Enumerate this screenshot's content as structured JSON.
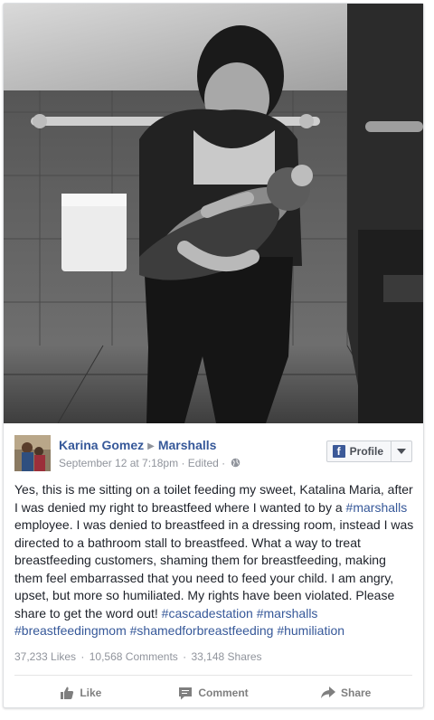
{
  "post": {
    "author": "Karina Gomez",
    "target": "Marshalls",
    "timestamp": "September 12 at 7:18pm",
    "edited": "Edited",
    "body_segments": [
      {
        "text": "Yes, this is me sitting on a toilet feeding my sweet, Katalina Maria, after I was denied my right to breastfeed where I wanted to by a ",
        "tag": false
      },
      {
        "text": "#marshalls",
        "tag": true
      },
      {
        "text": " employee. I was denied to breastfeed in a dressing room, instead I was directed to a bathroom stall to breastfeed. What a way to treat breastfeeding customers, shaming them for breastfeeding, making them feel embarrassed that you need to feed your child. I am angry, upset, but more so humiliated. My rights have been violated. Please share to get the word out! ",
        "tag": false
      },
      {
        "text": "#cascadestation",
        "tag": true
      },
      {
        "text": " ",
        "tag": false
      },
      {
        "text": "#marshalls",
        "tag": true
      },
      {
        "text": " ",
        "tag": false
      },
      {
        "text": "#breastfeedingmom",
        "tag": true
      },
      {
        "text": " ",
        "tag": false
      },
      {
        "text": "#shamedforbreastfeeding",
        "tag": true
      },
      {
        "text": " ",
        "tag": false
      },
      {
        "text": "#humiliation",
        "tag": true
      }
    ]
  },
  "header": {
    "profile_label": "Profile",
    "separator": "·"
  },
  "stats": {
    "likes": "37,233 Likes",
    "comments": "10,568 Comments",
    "shares": "33,148 Shares"
  },
  "actions": {
    "like": "Like",
    "comment": "Comment",
    "share": "Share"
  },
  "icons": {
    "brand": "facebook-f-icon",
    "privacy": "globe-icon",
    "dropdown": "chevron-down-icon",
    "like": "thumbs-up-icon",
    "comment": "speech-bubble-icon",
    "share": "share-arrow-icon"
  },
  "colors": {
    "link": "#365899",
    "meta": "#90949c",
    "text": "#1d2129",
    "brand": "#3b5998"
  }
}
